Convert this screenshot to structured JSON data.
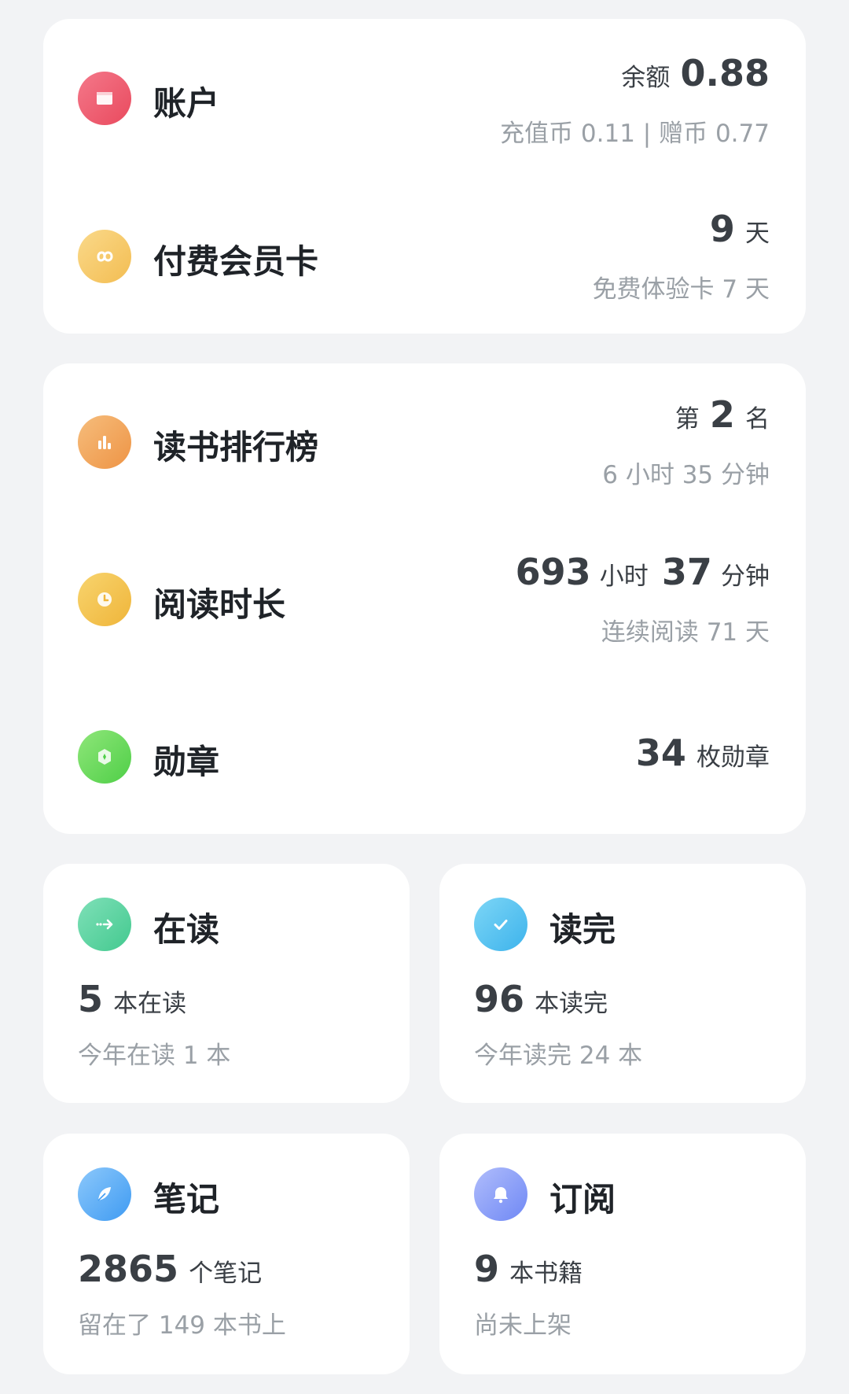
{
  "account": {
    "title": "账户",
    "balance_label": "余额",
    "balance_value": "0.88",
    "detail": "充值币 0.11 | 赠币 0.77"
  },
  "membership": {
    "title": "付费会员卡",
    "days_value": "9",
    "days_unit": "天",
    "detail": "免费体验卡 7 天"
  },
  "ranking": {
    "title": "读书排行榜",
    "prefix": "第",
    "rank_value": "2",
    "suffix": "名",
    "detail": "6 小时 35 分钟"
  },
  "reading_time": {
    "title": "阅读时长",
    "hours_value": "693",
    "hours_unit": "小时",
    "minutes_value": "37",
    "minutes_unit": "分钟",
    "detail": "连续阅读 71 天"
  },
  "badges": {
    "title": "勋章",
    "count_value": "34",
    "count_unit": "枚勋章"
  },
  "reading": {
    "title": "在读",
    "count_value": "5",
    "count_unit": "本在读",
    "detail": "今年在读 1 本"
  },
  "finished": {
    "title": "读完",
    "count_value": "96",
    "count_unit": "本读完",
    "detail": "今年读完 24 本"
  },
  "notes": {
    "title": "笔记",
    "count_value": "2865",
    "count_unit": "个笔记",
    "detail": "留在了 149 本书上"
  },
  "subscriptions": {
    "title": "订阅",
    "count_value": "9",
    "count_unit": "本书籍",
    "detail": "尚未上架"
  },
  "icons": {
    "account": "wallet-icon",
    "membership": "infinity-icon",
    "ranking": "bar-chart-icon",
    "reading_time": "clock-icon",
    "badges": "medal-icon",
    "reading": "arrow-right-icon",
    "finished": "check-icon",
    "notes": "feather-icon",
    "subscriptions": "bell-icon"
  },
  "colors": {
    "background": "#f2f3f5",
    "card": "#ffffff",
    "account_icon": "#ec5b6d",
    "membership_icon": "#f6c96a",
    "ranking_icon": "#f2a65a",
    "reading_time_icon": "#f4c24e",
    "badges_icon": "#62d95b",
    "reading_icon": "#55d4a2",
    "finished_icon": "#52bff0",
    "notes_icon": "#5aaef5",
    "subscriptions_icon": "#8ea1f8"
  }
}
